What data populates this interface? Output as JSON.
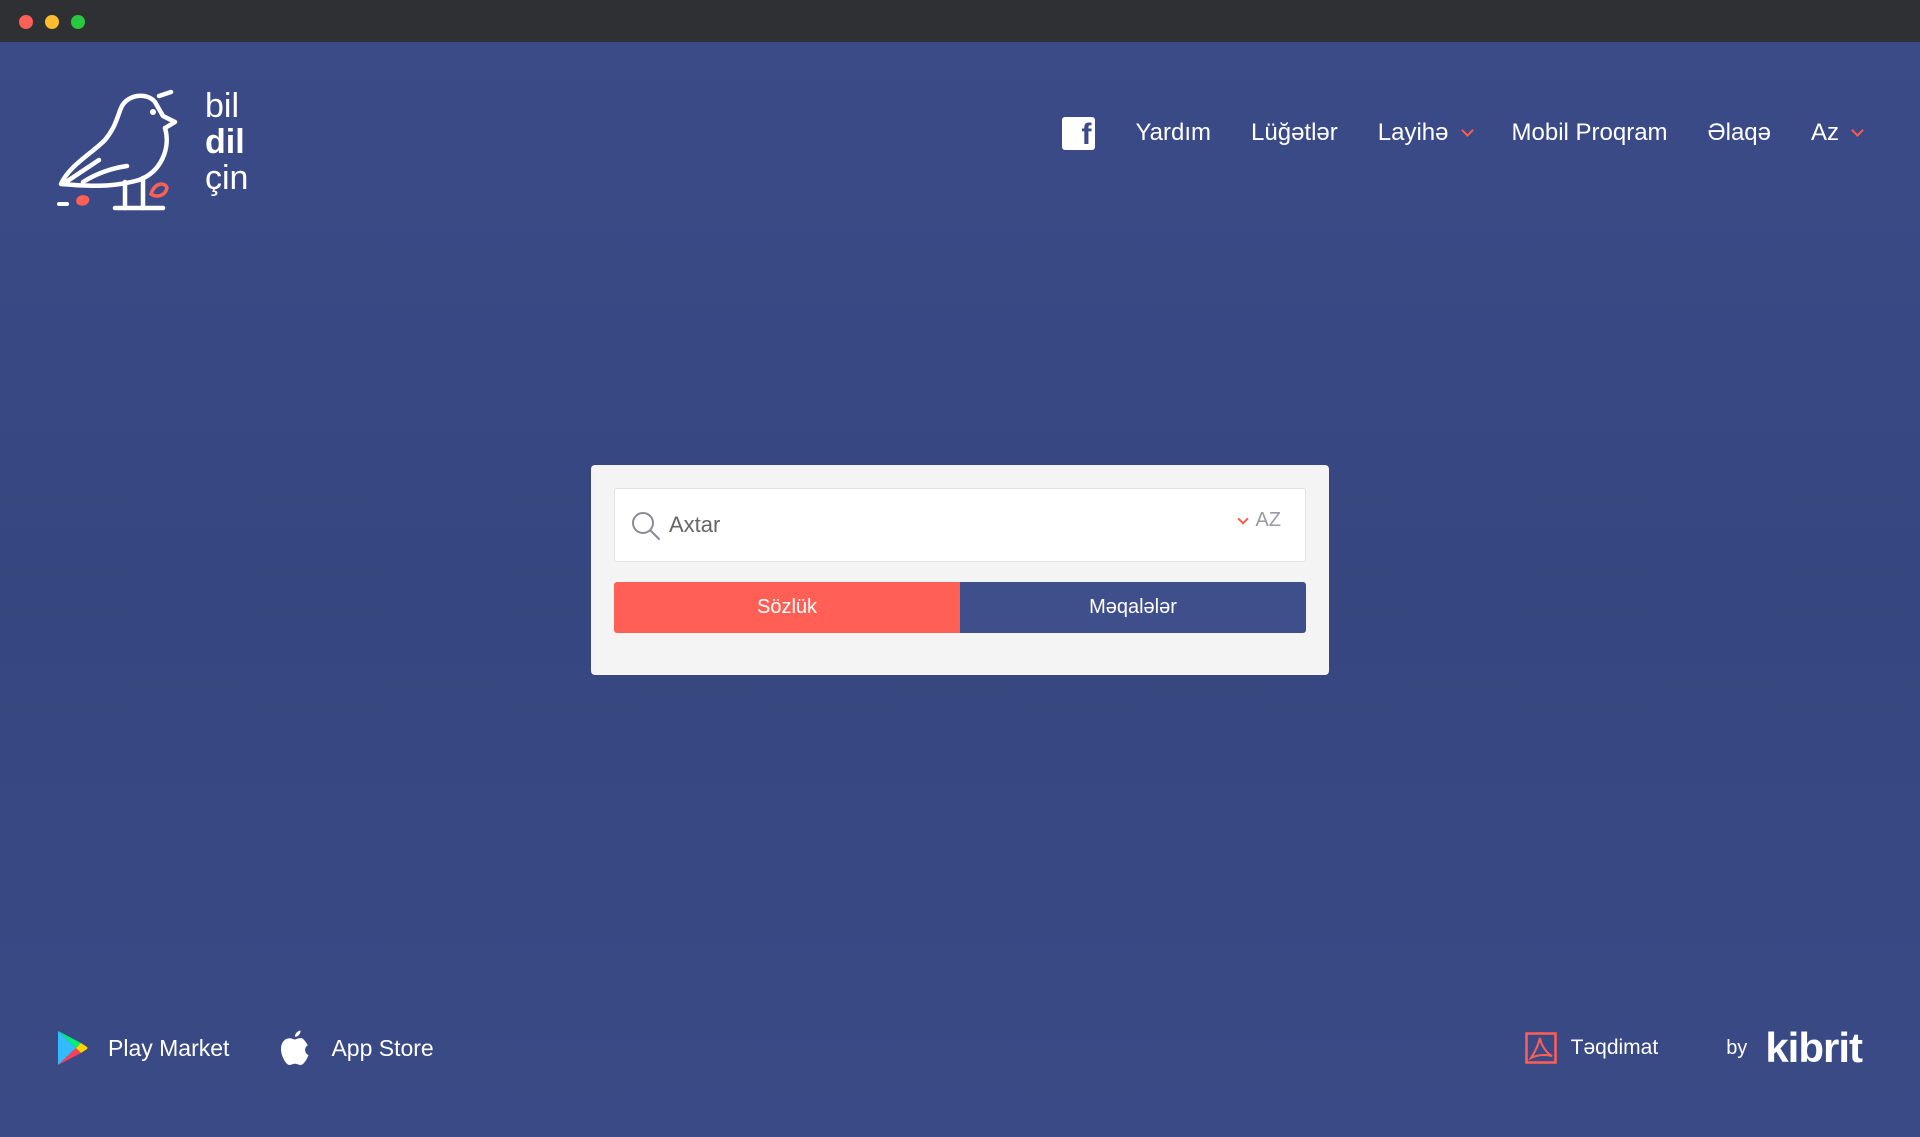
{
  "logo": {
    "line1": "bil",
    "line2": "dil",
    "line3": "çin"
  },
  "nav": {
    "items": [
      {
        "label": "Yardım",
        "has_dropdown": false
      },
      {
        "label": "Lüğətlər",
        "has_dropdown": false
      },
      {
        "label": "Layihə",
        "has_dropdown": true
      },
      {
        "label": "Mobil Proqram",
        "has_dropdown": false
      },
      {
        "label": "Əlaqə",
        "has_dropdown": false
      },
      {
        "label": "Az",
        "has_dropdown": true
      }
    ],
    "social_icon": "facebook-icon"
  },
  "search": {
    "placeholder": "Axtar",
    "value": "",
    "language": "AZ"
  },
  "tabs": [
    {
      "label": "Sözlük",
      "active": true
    },
    {
      "label": "Məqalələr",
      "active": false
    }
  ],
  "footer": {
    "play_market": "Play Market",
    "app_store": "App Store",
    "presentation": "Təqdimat",
    "by": "by",
    "brand": "kibrit"
  },
  "colors": {
    "background": "#3a4a86",
    "accent": "#ff5f54",
    "tab_inactive": "#3f4f8c",
    "card": "#f4f4f5"
  }
}
